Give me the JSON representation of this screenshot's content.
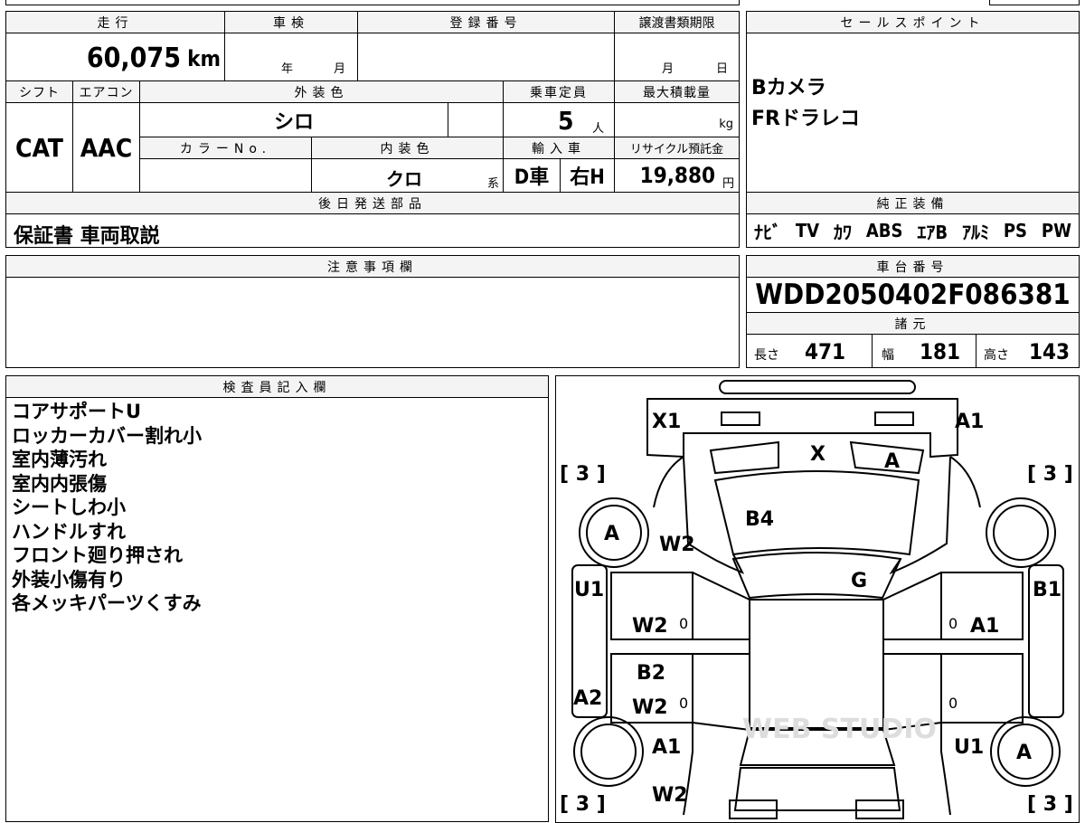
{
  "top": {
    "labels": {
      "mileage": "走行",
      "inspection": "車検",
      "reg_no": "登録番号",
      "transfer_deadline": "譲渡書類期限",
      "shift": "シフト",
      "aircon": "エアコン",
      "ext_color": "外装色",
      "capacity": "乗車定員",
      "max_load": "最大積載量",
      "color_no": "カラーNo.",
      "int_color": "内装色",
      "import": "輸入車",
      "recycle": "リサイクル預託金"
    },
    "mileage_value": "60,075",
    "mileage_unit": "km",
    "year_unit": "年",
    "month_unit": "月",
    "day_unit": "日",
    "shift_value": "CAT",
    "aircon_value": "AAC",
    "ext_color_value": "シロ",
    "capacity_value": "5",
    "capacity_unit": "人",
    "load_unit": "kg",
    "int_color_value": "クロ",
    "int_color_suffix": "系",
    "import_value": "D車",
    "handle_value": "右H",
    "recycle_value": "19,880",
    "recycle_unit": "円"
  },
  "sales_point": {
    "header": "セールスポイント",
    "lines": [
      "Bカメラ",
      "FRドラレコ"
    ]
  },
  "later_parts": {
    "header": "後日発送部品",
    "value": "保証書 車両取説"
  },
  "equipment": {
    "header": "純正装備",
    "items": [
      "ﾅﾋﾞ",
      "TV",
      "ｶﾜ",
      "ABS",
      "ｴｱB",
      "ｱﾙﾐ",
      "PS",
      "PW"
    ]
  },
  "notes": {
    "header": "注意事項欄"
  },
  "chassis": {
    "header": "車台番号",
    "value": "WDD2050402F086381"
  },
  "specs": {
    "header": "諸元",
    "length_label": "長さ",
    "length_value": "471",
    "width_label": "幅",
    "width_value": "181",
    "height_label": "高さ",
    "height_value": "143"
  },
  "inspector": {
    "header": "検査員記入欄",
    "lines": [
      "コアサポートU",
      "ロッカーカバー割れ小",
      "室内薄汚れ",
      "室内内張傷",
      "シートしわ小",
      "ハンドルすれ",
      "フロント廻り押され",
      "外装小傷有り",
      "各メッキパーツくすみ"
    ]
  },
  "diagram": {
    "marks": {
      "front_left_corner": "X1",
      "front_right_corner": "A1",
      "windshield_left": "X",
      "windshield_right": "A",
      "hood": "B4",
      "roof": "G",
      "front_left_wheel": "A",
      "front_left_fender": "W2",
      "left_front_pillar": "U1",
      "right_front_pillar": "B1",
      "left_front_door": "W2",
      "right_front_door": "A1",
      "left_rear_door_top": "B2",
      "left_rear_door": "W2",
      "left_rocker": "A2",
      "left_rear_fender": "A1",
      "left_rear_lower": "W2",
      "right_rear_fender": "U1",
      "rear_right_wheel": "A",
      "tire_fl": "3",
      "tire_fr": "3",
      "tire_rl": "3",
      "tire_rr": "3",
      "door_marker": "0"
    },
    "watermark": "WEB STUDIO"
  }
}
